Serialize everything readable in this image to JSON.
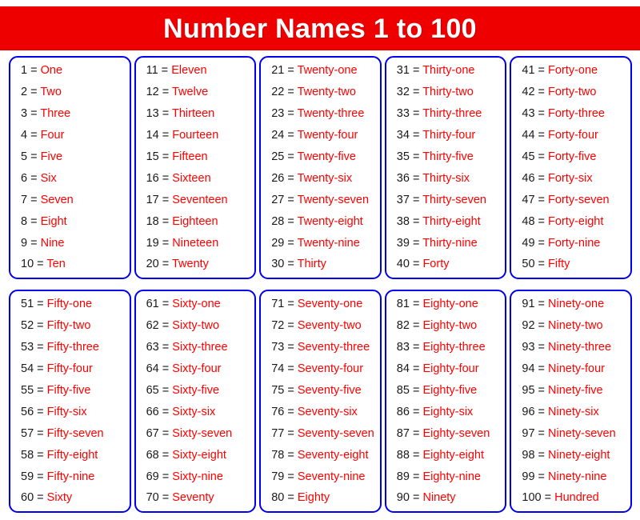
{
  "header": {
    "title": "Number Names 1 to 100",
    "banner_color": "#ee0000",
    "title_color": "#ffffff"
  },
  "style": {
    "card_border_color": "#0000ee",
    "number_color": "#1a1a1a",
    "word_color": "#ff0000",
    "equals_symbol": "="
  },
  "cards": [
    {
      "name": "card-1-10",
      "entries": [
        {
          "number": "1",
          "word": "One"
        },
        {
          "number": "2",
          "word": "Two"
        },
        {
          "number": "3",
          "word": "Three"
        },
        {
          "number": "4",
          "word": "Four"
        },
        {
          "number": "5",
          "word": "Five"
        },
        {
          "number": "6",
          "word": "Six"
        },
        {
          "number": "7",
          "word": "Seven"
        },
        {
          "number": "8",
          "word": "Eight"
        },
        {
          "number": "9",
          "word": "Nine"
        },
        {
          "number": "10",
          "word": "Ten"
        }
      ]
    },
    {
      "name": "card-11-20",
      "entries": [
        {
          "number": "11",
          "word": "Eleven"
        },
        {
          "number": "12",
          "word": "Twelve"
        },
        {
          "number": "13",
          "word": "Thirteen"
        },
        {
          "number": "14",
          "word": "Fourteen"
        },
        {
          "number": "15",
          "word": "Fifteen"
        },
        {
          "number": "16",
          "word": "Sixteen"
        },
        {
          "number": "17",
          "word": "Seventeen"
        },
        {
          "number": "18",
          "word": "Eighteen"
        },
        {
          "number": "19",
          "word": "Nineteen"
        },
        {
          "number": "20",
          "word": "Twenty"
        }
      ]
    },
    {
      "name": "card-21-30",
      "entries": [
        {
          "number": "21",
          "word": "Twenty-one"
        },
        {
          "number": "22",
          "word": "Twenty-two"
        },
        {
          "number": "23",
          "word": "Twenty-three"
        },
        {
          "number": "24",
          "word": "Twenty-four"
        },
        {
          "number": "25",
          "word": "Twenty-five"
        },
        {
          "number": "26",
          "word": "Twenty-six"
        },
        {
          "number": "27",
          "word": "Twenty-seven"
        },
        {
          "number": "28",
          "word": "Twenty-eight"
        },
        {
          "number": "29",
          "word": "Twenty-nine"
        },
        {
          "number": "30",
          "word": "Thirty"
        }
      ]
    },
    {
      "name": "card-31-40",
      "entries": [
        {
          "number": "31",
          "word": "Thirty-one"
        },
        {
          "number": "32",
          "word": "Thirty-two"
        },
        {
          "number": "33",
          "word": "Thirty-three"
        },
        {
          "number": "34",
          "word": "Thirty-four"
        },
        {
          "number": "35",
          "word": "Thirty-five"
        },
        {
          "number": "36",
          "word": "Thirty-six"
        },
        {
          "number": "37",
          "word": "Thirty-seven"
        },
        {
          "number": "38",
          "word": "Thirty-eight"
        },
        {
          "number": "39",
          "word": "Thirty-nine"
        },
        {
          "number": "40",
          "word": "Forty"
        }
      ]
    },
    {
      "name": "card-41-50",
      "entries": [
        {
          "number": "41",
          "word": "Forty-one"
        },
        {
          "number": "42",
          "word": "Forty-two"
        },
        {
          "number": "43",
          "word": "Forty-three"
        },
        {
          "number": "44",
          "word": "Forty-four"
        },
        {
          "number": "45",
          "word": "Forty-five"
        },
        {
          "number": "46",
          "word": "Forty-six"
        },
        {
          "number": "47",
          "word": "Forty-seven"
        },
        {
          "number": "48",
          "word": "Forty-eight"
        },
        {
          "number": "49",
          "word": "Forty-nine"
        },
        {
          "number": "50",
          "word": "Fifty"
        }
      ]
    },
    {
      "name": "card-51-60",
      "entries": [
        {
          "number": "51",
          "word": "Fifty-one"
        },
        {
          "number": "52",
          "word": "Fifty-two"
        },
        {
          "number": "53",
          "word": "Fifty-three"
        },
        {
          "number": "54",
          "word": "Fifty-four"
        },
        {
          "number": "55",
          "word": "Fifty-five"
        },
        {
          "number": "56",
          "word": "Fifty-six"
        },
        {
          "number": "57",
          "word": "Fifty-seven"
        },
        {
          "number": "58",
          "word": "Fifty-eight"
        },
        {
          "number": "59",
          "word": "Fifty-nine"
        },
        {
          "number": "60",
          "word": "Sixty"
        }
      ]
    },
    {
      "name": "card-61-70",
      "entries": [
        {
          "number": "61",
          "word": "Sixty-one"
        },
        {
          "number": "62",
          "word": "Sixty-two"
        },
        {
          "number": "63",
          "word": "Sixty-three"
        },
        {
          "number": "64",
          "word": "Sixty-four"
        },
        {
          "number": "65",
          "word": "Sixty-five"
        },
        {
          "number": "66",
          "word": "Sixty-six"
        },
        {
          "number": "67",
          "word": "Sixty-seven"
        },
        {
          "number": "68",
          "word": "Sixty-eight"
        },
        {
          "number": "69",
          "word": "Sixty-nine"
        },
        {
          "number": "70",
          "word": "Seventy"
        }
      ]
    },
    {
      "name": "card-71-80",
      "entries": [
        {
          "number": "71",
          "word": "Seventy-one"
        },
        {
          "number": "72",
          "word": "Seventy-two"
        },
        {
          "number": "73",
          "word": "Seventy-three"
        },
        {
          "number": "74",
          "word": "Seventy-four"
        },
        {
          "number": "75",
          "word": "Seventy-five"
        },
        {
          "number": "76",
          "word": "Seventy-six"
        },
        {
          "number": "77",
          "word": "Seventy-seven"
        },
        {
          "number": "78",
          "word": "Seventy-eight"
        },
        {
          "number": "79",
          "word": "Seventy-nine"
        },
        {
          "number": "80",
          "word": "Eighty"
        }
      ]
    },
    {
      "name": "card-81-90",
      "entries": [
        {
          "number": "81",
          "word": "Eighty-one"
        },
        {
          "number": "82",
          "word": "Eighty-two"
        },
        {
          "number": "83",
          "word": "Eighty-three"
        },
        {
          "number": "84",
          "word": "Eighty-four"
        },
        {
          "number": "85",
          "word": "Eighty-five"
        },
        {
          "number": "86",
          "word": "Eighty-six"
        },
        {
          "number": "87",
          "word": "Eighty-seven"
        },
        {
          "number": "88",
          "word": "Eighty-eight"
        },
        {
          "number": "89",
          "word": "Eighty-nine"
        },
        {
          "number": "90",
          "word": "Ninety"
        }
      ]
    },
    {
      "name": "card-91-100",
      "entries": [
        {
          "number": "91",
          "word": "Ninety-one"
        },
        {
          "number": "92",
          "word": "Ninety-two"
        },
        {
          "number": "93",
          "word": "Ninety-three"
        },
        {
          "number": "94",
          "word": "Ninety-four"
        },
        {
          "number": "95",
          "word": "Ninety-five"
        },
        {
          "number": "96",
          "word": "Ninety-six"
        },
        {
          "number": "97",
          "word": "Ninety-seven"
        },
        {
          "number": "98",
          "word": "Ninety-eight"
        },
        {
          "number": "99",
          "word": "Ninety-nine"
        },
        {
          "number": "100",
          "word": "Hundred"
        }
      ]
    }
  ]
}
